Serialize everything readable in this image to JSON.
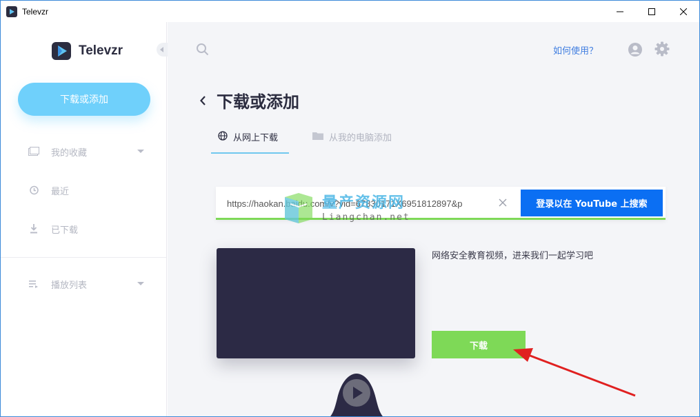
{
  "window": {
    "title": "Televzr"
  },
  "sidebar": {
    "brand": "Televzr",
    "add_button": "下载或添加",
    "items": [
      {
        "label": "我的收藏",
        "icon": "folder-icon",
        "has_caret": true
      },
      {
        "label": "最近",
        "icon": "history-icon",
        "has_caret": false
      },
      {
        "label": "已下载",
        "icon": "download-icon",
        "has_caret": false
      },
      {
        "label": "播放列表",
        "icon": "playlist-icon",
        "has_caret": true
      }
    ]
  },
  "header": {
    "help_link": "如何使用？"
  },
  "page": {
    "title": "下载或添加",
    "tabs": [
      {
        "label": "从网上下载",
        "icon": "globe-icon",
        "active": true
      },
      {
        "label": "从我的电脑添加",
        "icon": "folder-icon",
        "active": false
      }
    ],
    "url_input": {
      "value": "https://haokan.baidu.com/v?vid=67830171X6951812897&p"
    },
    "search_button": "登录以在 YouTube 上搜索",
    "video": {
      "title": "网络安全教育视频，进来我们一起学习吧",
      "download_button": "下载"
    }
  },
  "watermark": {
    "cn": "量产资源网",
    "en": "Liangchan.net"
  },
  "colors": {
    "accent": "#6fd0fb",
    "primary_button": "#0b6ff3",
    "success": "#7ed957",
    "thumbnail": "#2c2a45",
    "annotation_arrow": "#e02020"
  }
}
